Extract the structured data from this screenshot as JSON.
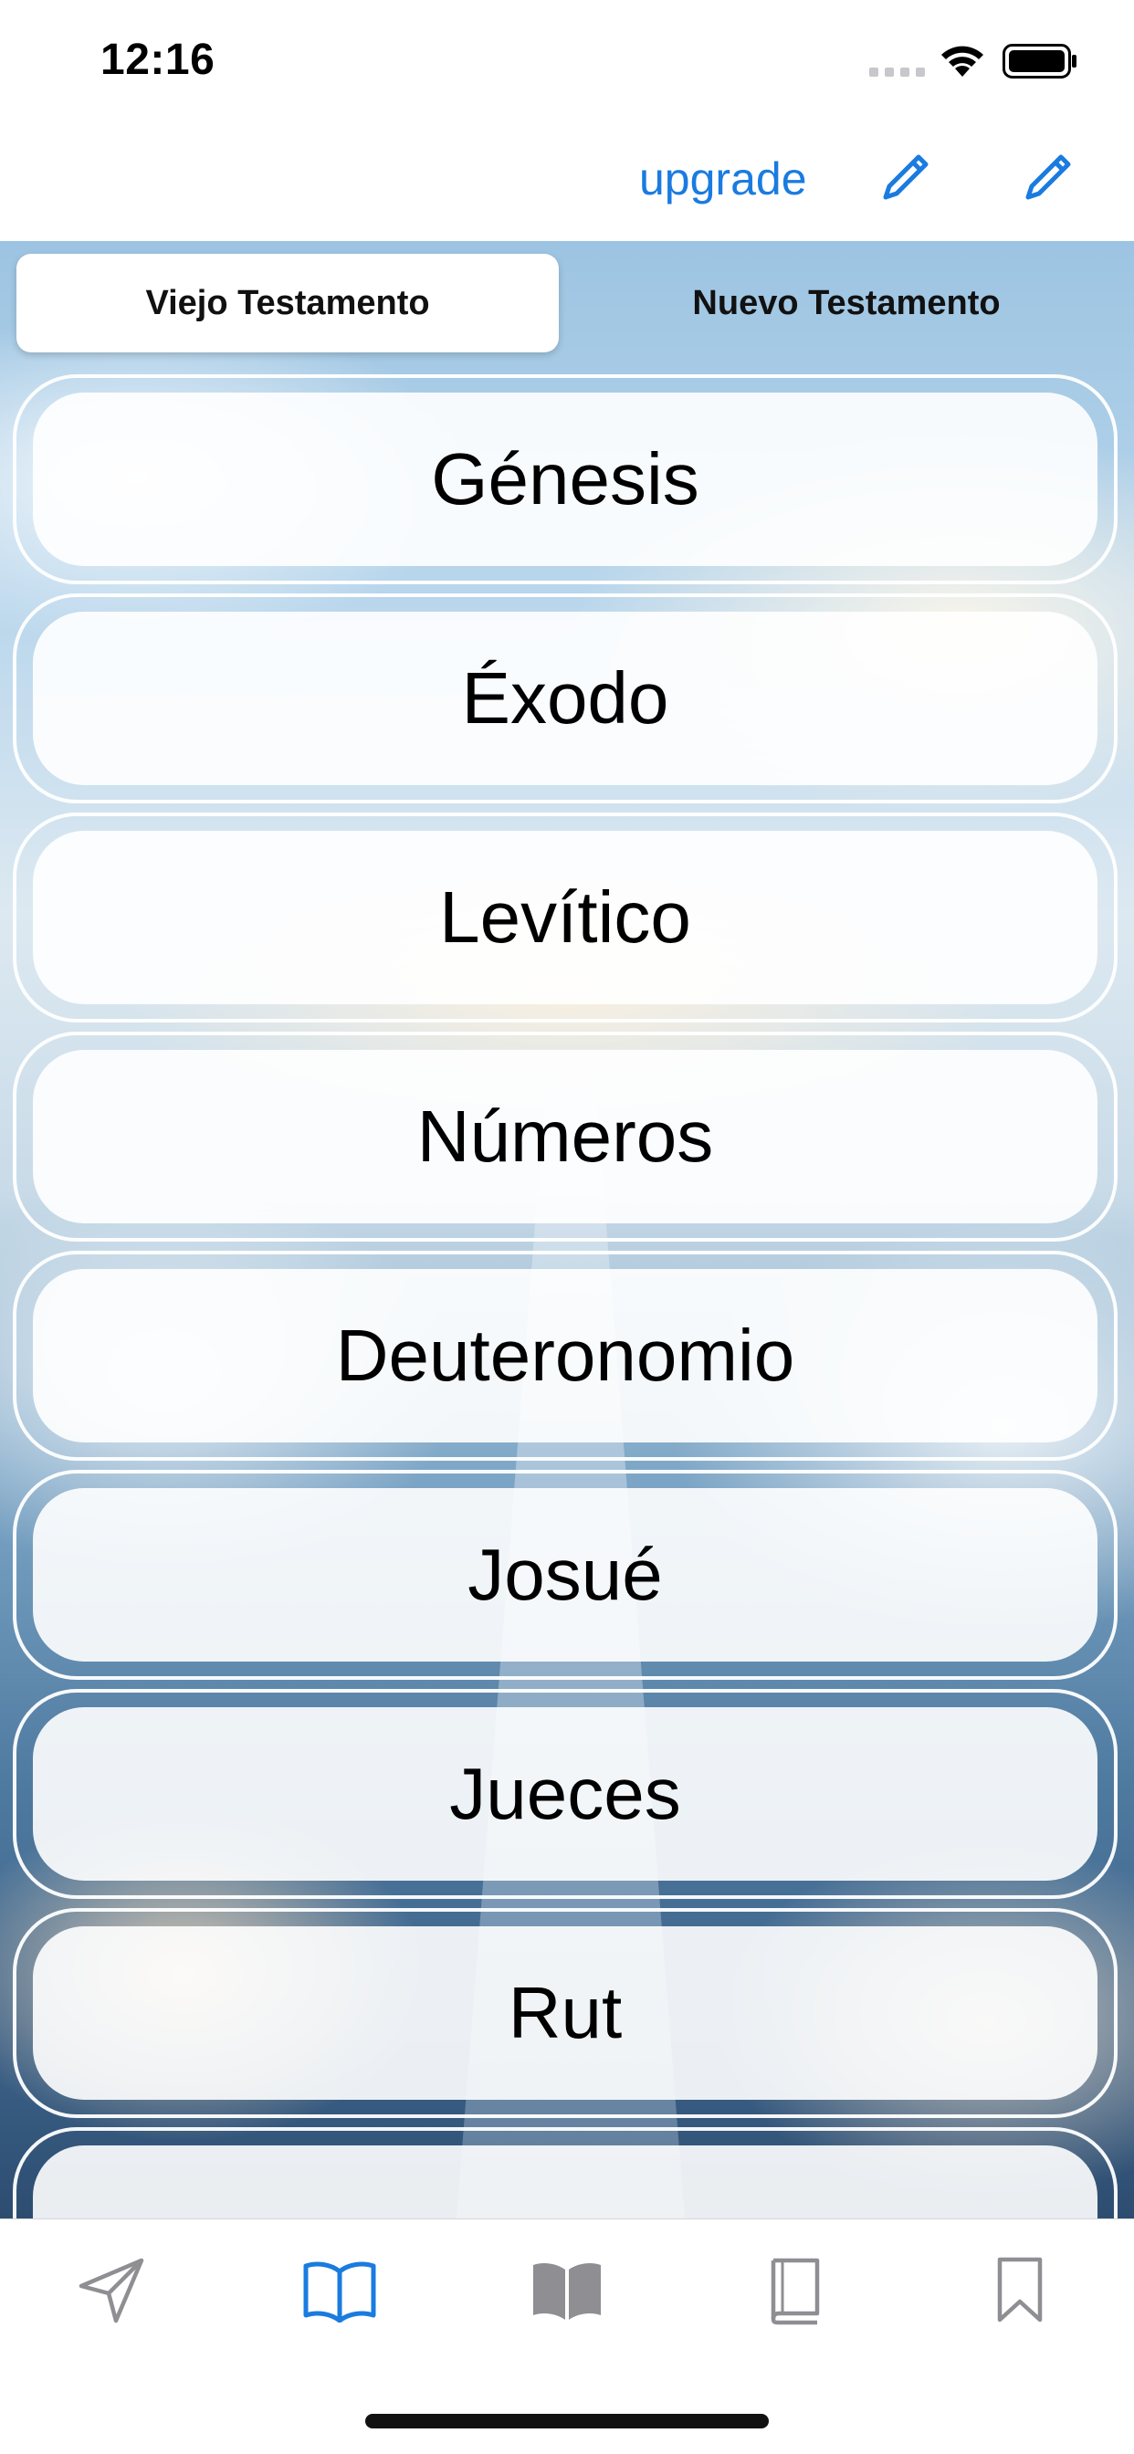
{
  "status_bar": {
    "time": "12:16"
  },
  "nav": {
    "upgrade_label": "upgrade",
    "edit_icon_1": "pencil-icon",
    "edit_icon_2": "pencil-icon",
    "accent_color": "#1a7be0"
  },
  "segments": {
    "old_testament": "Viejo Testamento",
    "new_testament": "Nuevo Testamento",
    "selected": "Viejo Testamento"
  },
  "books": [
    {
      "label": "Génesis"
    },
    {
      "label": "Éxodo"
    },
    {
      "label": "Levítico"
    },
    {
      "label": "Números"
    },
    {
      "label": "Deuteronomio"
    },
    {
      "label": "Josué"
    },
    {
      "label": "Jueces"
    },
    {
      "label": "Rut"
    },
    {
      "label": ""
    }
  ],
  "tab_bar": {
    "tabs": [
      {
        "icon": "send-icon",
        "active": false
      },
      {
        "icon": "open-book-icon",
        "active": true
      },
      {
        "icon": "filled-book-icon",
        "active": false
      },
      {
        "icon": "closed-book-icon",
        "active": false
      },
      {
        "icon": "bookmark-icon",
        "active": false
      }
    ],
    "active_color": "#1a7be0",
    "inactive_color": "#8e8e93"
  }
}
